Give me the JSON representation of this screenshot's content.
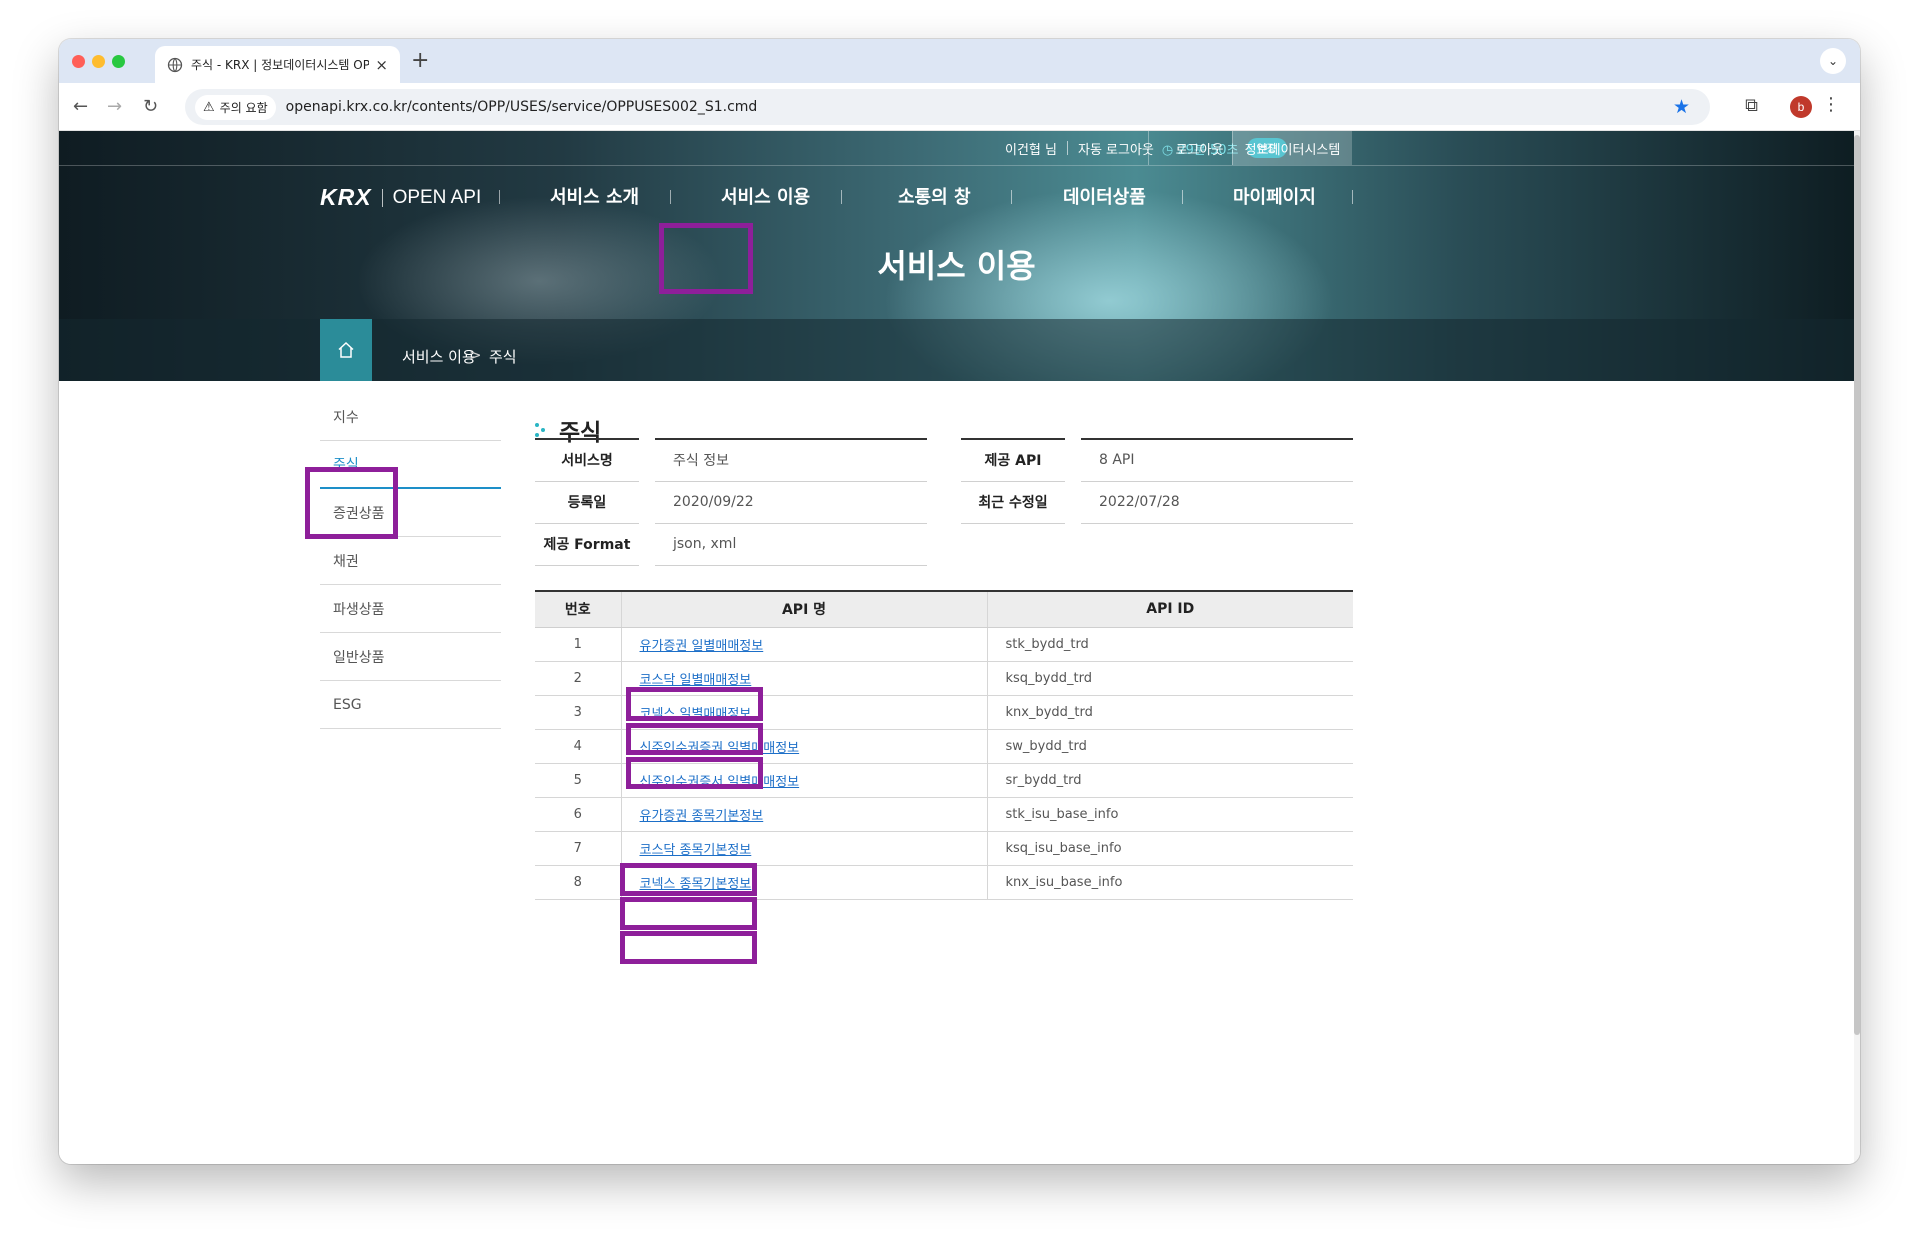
{
  "browser": {
    "tab_title": "주식 - KRX | 정보데이터시스템 OP",
    "close_glyph": "×",
    "new_tab_glyph": "+",
    "tab_menu_glyph": "⌄",
    "security_chip": "주의 요함",
    "url": "openapi.krx.co.kr/contents/OPP/USES/service/OPPUSES002_S1.cmd",
    "profile_initial": "b",
    "colors": {
      "traffic_red": "#ff5f57",
      "traffic_yellow": "#febc2e",
      "traffic_green": "#28c840",
      "accent": "#1a73e8"
    }
  },
  "util": {
    "user": "이건협 님",
    "auto_logout_label": "자동 로그아웃",
    "timer": "29분 50초",
    "extend": "연장",
    "logout": "로그아웃",
    "system": "정보데이터시스템"
  },
  "logo": {
    "brand": "KRX",
    "product": "OPEN API"
  },
  "gnav": [
    "서비스 소개",
    "서비스 이용",
    "소통의 창",
    "데이터상품",
    "마이페이지"
  ],
  "hero_title": "서비스 이용",
  "breadcrumb": {
    "level1": "서비스 이용",
    "separator": ">",
    "level2": "주식"
  },
  "sidebar": {
    "items": [
      "지수",
      "주식",
      "증권상품",
      "채권",
      "파생상품",
      "일반상품",
      "ESG"
    ],
    "active_index": 1
  },
  "section_title": "주식",
  "info": {
    "service_name_label": "서비스명",
    "service_name": "주식 정보",
    "api_count_label": "제공 API",
    "api_count": "8 API",
    "registered_label": "등록일",
    "registered": "2020/09/22",
    "modified_label": "최근 수정일",
    "modified": "2022/07/28",
    "format_label": "제공 Format",
    "format": "json, xml"
  },
  "api_table": {
    "headers": [
      "번호",
      "API 명",
      "API ID"
    ],
    "rows": [
      {
        "no": "1",
        "name": "유가증권 일별매매정보",
        "id": "stk_bydd_trd"
      },
      {
        "no": "2",
        "name": "코스닥 일별매매정보",
        "id": "ksq_bydd_trd"
      },
      {
        "no": "3",
        "name": "코넥스 일별매매정보",
        "id": "knx_bydd_trd"
      },
      {
        "no": "4",
        "name": "신주인수권증권 일별매매정보",
        "id": "sw_bydd_trd"
      },
      {
        "no": "5",
        "name": "신주인수권증서 일별매매정보",
        "id": "sr_bydd_trd"
      },
      {
        "no": "6",
        "name": "유가증권 종목기본정보",
        "id": "stk_isu_base_info"
      },
      {
        "no": "7",
        "name": "코스닥 종목기본정보",
        "id": "ksq_isu_base_info"
      },
      {
        "no": "8",
        "name": "코넥스 종목기본정보",
        "id": "knx_isu_base_info"
      }
    ]
  },
  "annotation_color": "#8e1f9a"
}
